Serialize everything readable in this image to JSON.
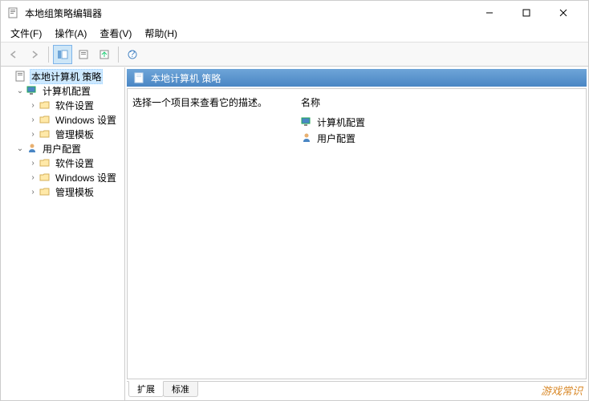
{
  "window": {
    "title": "本地组策略编辑器"
  },
  "menu": {
    "file": "文件(F)",
    "action": "操作(A)",
    "view": "查看(V)",
    "help": "帮助(H)"
  },
  "tree": {
    "root": "本地计算机 策略",
    "computer": "计算机配置",
    "computer_children": {
      "software": "软件设置",
      "windows": "Windows 设置",
      "admin": "管理模板"
    },
    "user": "用户配置",
    "user_children": {
      "software": "软件设置",
      "windows": "Windows 设置",
      "admin": "管理模板"
    }
  },
  "content": {
    "header": "本地计算机 策略",
    "description": "选择一个项目来查看它的描述。",
    "column_name": "名称",
    "items": {
      "computer": "计算机配置",
      "user": "用户配置"
    }
  },
  "tabs": {
    "extended": "扩展",
    "standard": "标准"
  },
  "watermark": "游戏常识"
}
